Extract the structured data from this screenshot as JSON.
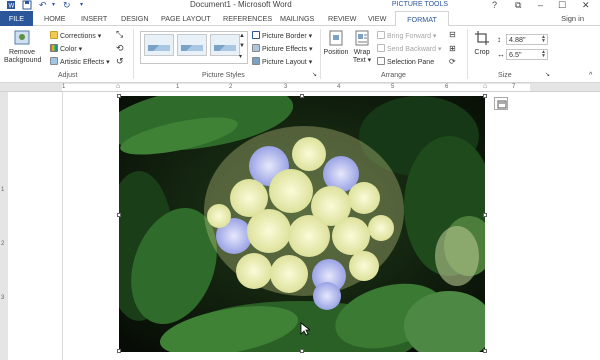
{
  "window": {
    "title": "Document1 - Microsoft Word",
    "context_tab_group": "PICTURE TOOLS",
    "controls": {
      "help": "?",
      "restore": "⧉",
      "minimize": "–",
      "maximize": "☐",
      "close": "✕"
    }
  },
  "quick_access": {
    "save": "💾",
    "undo": "↶",
    "redo": "↻"
  },
  "tabs": [
    {
      "label": "FILE"
    },
    {
      "label": "HOME"
    },
    {
      "label": "INSERT"
    },
    {
      "label": "DESIGN"
    },
    {
      "label": "PAGE LAYOUT"
    },
    {
      "label": "REFERENCES"
    },
    {
      "label": "MAILINGS"
    },
    {
      "label": "REVIEW"
    },
    {
      "label": "VIEW"
    },
    {
      "label": "FORMAT"
    }
  ],
  "account": {
    "signin": "Sign in"
  },
  "ribbon": {
    "adjust": {
      "label": "Adjust",
      "remove_background_1": "Remove",
      "remove_background_2": "Background",
      "corrections": "Corrections ▾",
      "color": "Color ▾",
      "artistic_effects": "Artistic Effects ▾"
    },
    "picture_styles": {
      "label": "Picture Styles",
      "picture_border": "Picture Border ▾",
      "picture_effects": "Picture Effects ▾",
      "picture_layout": "Picture Layout ▾"
    },
    "arrange": {
      "label": "Arrange",
      "position": "Position",
      "wrap_text_1": "Wrap",
      "wrap_text_2": "Text ▾",
      "bring_forward": "Bring Forward ▾",
      "send_backward": "Send Backward ▾",
      "selection_pane": "Selection Pane"
    },
    "size": {
      "label": "Size",
      "crop": "Crop",
      "height": "4.88\"",
      "width": "6.5\""
    }
  },
  "ruler": {
    "numbers": [
      "1",
      "1",
      "2",
      "3",
      "4",
      "5",
      "6",
      "7"
    ]
  },
  "vruler": {
    "numbers": [
      "1",
      "2",
      "3"
    ]
  },
  "colors": {
    "accent": "#2b579a",
    "file_tab": "#2b579a"
  }
}
